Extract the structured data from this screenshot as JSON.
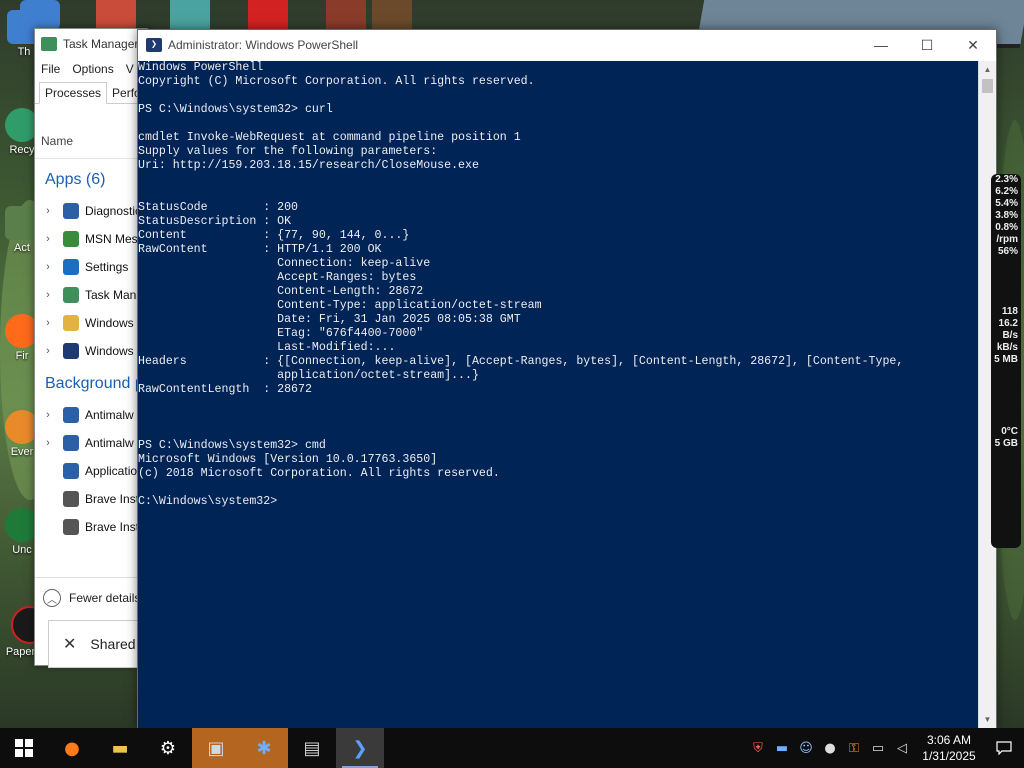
{
  "desktop": {
    "icons": [
      {
        "label": "Th"
      },
      {
        "label": "Recy"
      },
      {
        "label": "Act"
      },
      {
        "label": "Fir"
      },
      {
        "label": "Ever"
      },
      {
        "label": "Unc"
      },
      {
        "label": "Papers, P"
      }
    ]
  },
  "task_manager": {
    "title": "Task Manager",
    "menu": [
      "File",
      "Options",
      "V"
    ],
    "tabs": [
      "Processes",
      "Perfor"
    ],
    "column_name": "Name",
    "apps_header": "Apps (6)",
    "apps": [
      {
        "label": "Diagnostic",
        "icon": "diagnostic-icon",
        "color": "#2b5fa6"
      },
      {
        "label": "MSN Mes",
        "icon": "msn-icon",
        "color": "#3a8c3a"
      },
      {
        "label": "Settings",
        "icon": "settings-icon",
        "color": "#1a6fc2"
      },
      {
        "label": "Task Mana",
        "icon": "task-manager-icon",
        "color": "#3f8f5c"
      },
      {
        "label": "Windows",
        "icon": "explorer-icon",
        "color": "#e3b341"
      },
      {
        "label": "Windows",
        "icon": "powershell-icon",
        "color": "#1f3a73"
      }
    ],
    "background_header": "Background p",
    "background": [
      {
        "label": "Antimalw",
        "icon": "service-icon",
        "color": "#2b5fa6",
        "expandable": true
      },
      {
        "label": "Antimalw",
        "icon": "service-icon",
        "color": "#2b5fa6",
        "expandable": true
      },
      {
        "label": "Applicatio",
        "icon": "service-icon",
        "color": "#2b5fa6",
        "expandable": false
      },
      {
        "label": "Brave Inst",
        "icon": "gear-icon",
        "color": "#555555",
        "expandable": false
      },
      {
        "label": "Brave Inst",
        "icon": "gear-icon",
        "color": "#555555",
        "expandable": false
      }
    ],
    "fewer_details": "Fewer details"
  },
  "shared_window": {
    "label": "Shared"
  },
  "powershell": {
    "title": "Administrator: Windows PowerShell",
    "console_text": "Windows PowerShell\nCopyright (C) Microsoft Corporation. All rights reserved.\n\nPS C:\\Windows\\system32> curl\n\ncmdlet Invoke-WebRequest at command pipeline position 1\nSupply values for the following parameters:\nUri: http://159.203.18.15/research/CloseMouse.exe\n\n\nStatusCode        : 200\nStatusDescription : OK\nContent           : {77, 90, 144, 0...}\nRawContent        : HTTP/1.1 200 OK\n                    Connection: keep-alive\n                    Accept-Ranges: bytes\n                    Content-Length: 28672\n                    Content-Type: application/octet-stream\n                    Date: Fri, 31 Jan 2025 08:05:38 GMT\n                    ETag: \"676f4400-7000\"\n                    Last-Modified:...\nHeaders           : {[Connection, keep-alive], [Accept-Ranges, bytes], [Content-Length, 28672], [Content-Type,\n                    application/octet-stream]...}\nRawContentLength  : 28672\n\n\n\nPS C:\\Windows\\system32> cmd\nMicrosoft Windows [Version 10.0.17763.3650]\n(c) 2018 Microsoft Corporation. All rights reserved.\n\nC:\\Windows\\system32>",
    "colors": {
      "background": "#012456",
      "text": "#eeedf0"
    }
  },
  "gadget": {
    "lines": [
      "2.3%",
      "6.2%",
      "5.4%",
      "3.8%",
      "0.8%",
      "/rpm",
      "56%",
      "",
      "",
      "",
      "",
      "118",
      "16.2",
      "B/s",
      "kB/s",
      "5 MB",
      "",
      "",
      "",
      "",
      "",
      "0°C",
      "5 GB"
    ]
  },
  "taskbar": {
    "apps": [
      {
        "name": "firefox-icon",
        "glyph": "●",
        "color": "#ff7a1a"
      },
      {
        "name": "file-explorer-icon",
        "glyph": "▬",
        "color": "#f2c14e"
      },
      {
        "name": "settings-gear-icon",
        "glyph": "⚙",
        "color": "#ffffff"
      },
      {
        "name": "notepad-icon",
        "glyph": "▣",
        "color": "#cfd8e3"
      },
      {
        "name": "network-app-icon",
        "glyph": "✱",
        "color": "#6db0ff"
      },
      {
        "name": "remote-icon",
        "glyph": "▤",
        "color": "#d0d0d0"
      },
      {
        "name": "powershell-taskbar-icon",
        "glyph": "❯",
        "color": "#5aa0ff"
      }
    ],
    "tray_icons": [
      "shield-icon",
      "monitor-icon",
      "people-icon",
      "drop-icon",
      "key-icon",
      "network-icon",
      "volume-icon"
    ],
    "time": "3:06 AM",
    "date": "1/31/2025"
  }
}
